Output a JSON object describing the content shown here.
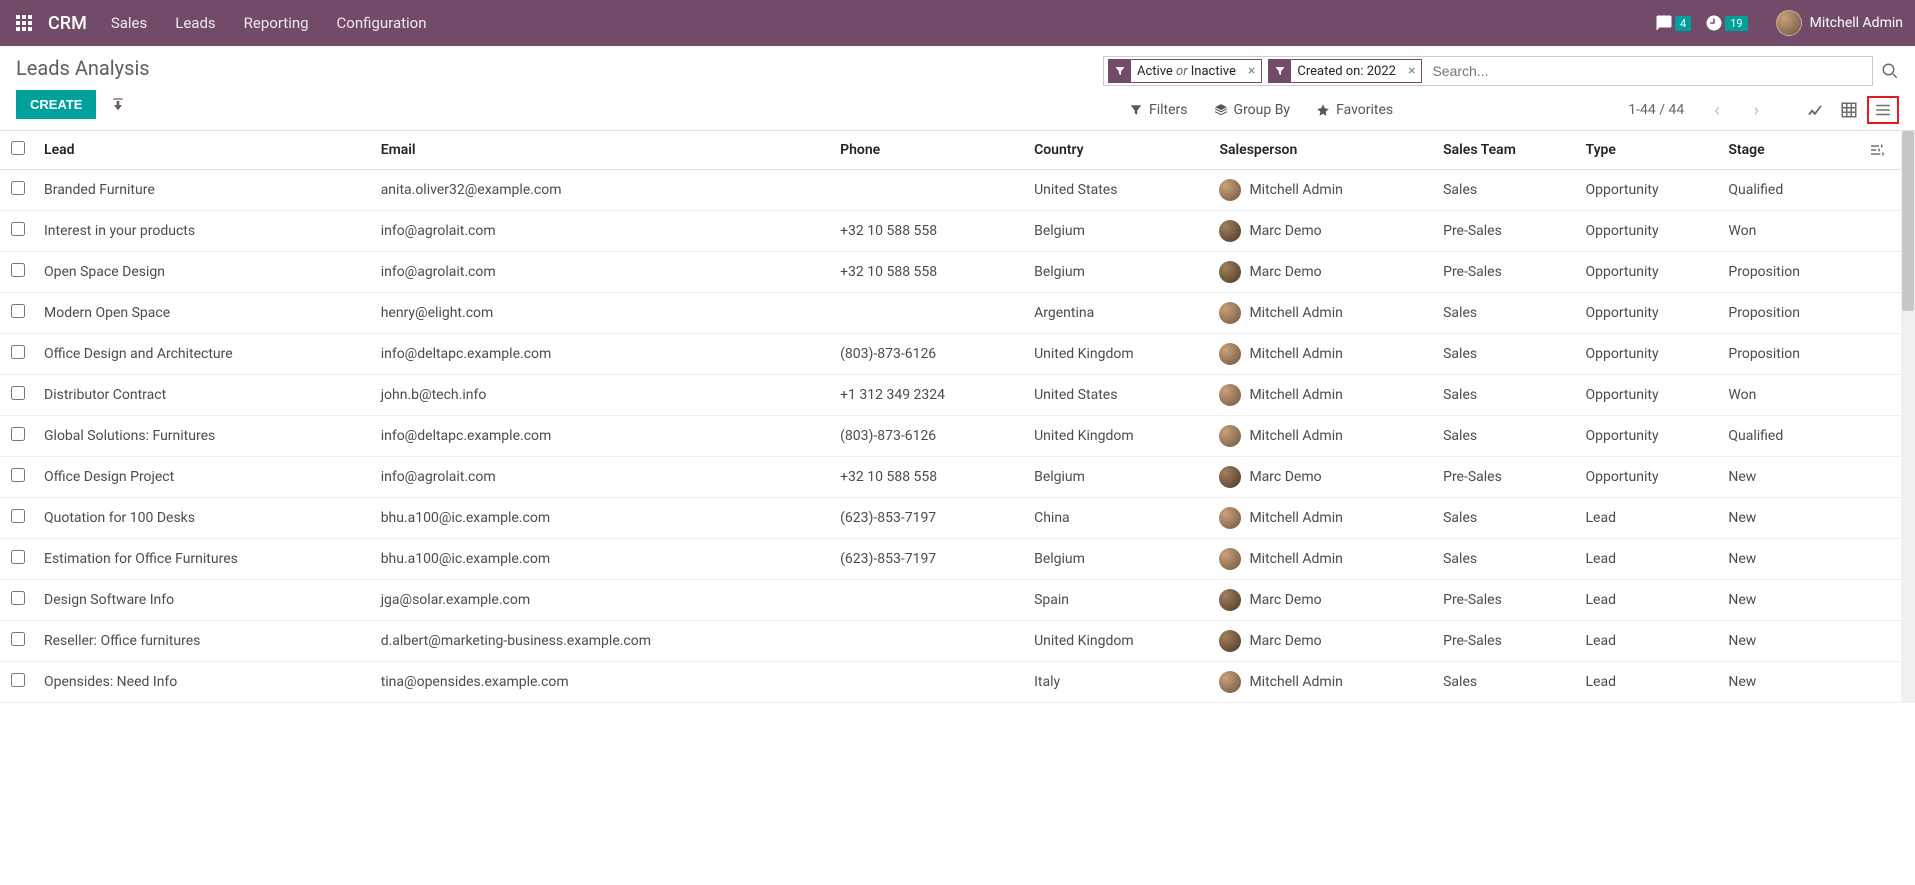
{
  "nav": {
    "brand": "CRM",
    "items": [
      "Sales",
      "Leads",
      "Reporting",
      "Configuration"
    ],
    "msg_badge": "4",
    "clock_badge": "19",
    "user": "Mitchell Admin"
  },
  "page": {
    "title": "Leads Analysis",
    "create_label": "CREATE"
  },
  "search": {
    "facet1_pre": "Active",
    "facet1_mid": "or",
    "facet1_post": "Inactive",
    "facet2": "Created on: 2022",
    "placeholder": "Search..."
  },
  "toolbar": {
    "filters": "Filters",
    "groupby": "Group By",
    "favorites": "Favorites",
    "pager": "1-44 / 44"
  },
  "columns": {
    "lead": "Lead",
    "email": "Email",
    "phone": "Phone",
    "country": "Country",
    "salesperson": "Salesperson",
    "salesteam": "Sales Team",
    "type": "Type",
    "stage": "Stage"
  },
  "rows": [
    {
      "lead": "Branded Furniture",
      "email": "anita.oliver32@example.com",
      "phone": "",
      "country": "United States",
      "sp": "Mitchell Admin",
      "team": "Sales",
      "type": "Opportunity",
      "stage": "Qualified",
      "av": "a"
    },
    {
      "lead": "Interest in your products",
      "email": "info@agrolait.com",
      "phone": "+32 10 588 558",
      "country": "Belgium",
      "sp": "Marc Demo",
      "team": "Pre-Sales",
      "type": "Opportunity",
      "stage": "Won",
      "av": "b"
    },
    {
      "lead": "Open Space Design",
      "email": "info@agrolait.com",
      "phone": "+32 10 588 558",
      "country": "Belgium",
      "sp": "Marc Demo",
      "team": "Pre-Sales",
      "type": "Opportunity",
      "stage": "Proposition",
      "av": "b"
    },
    {
      "lead": "Modern Open Space",
      "email": "henry@elight.com",
      "phone": "",
      "country": "Argentina",
      "sp": "Mitchell Admin",
      "team": "Sales",
      "type": "Opportunity",
      "stage": "Proposition",
      "av": "a"
    },
    {
      "lead": "Office Design and Architecture",
      "email": "info@deltapc.example.com",
      "phone": "(803)-873-6126",
      "country": "United Kingdom",
      "sp": "Mitchell Admin",
      "team": "Sales",
      "type": "Opportunity",
      "stage": "Proposition",
      "av": "a"
    },
    {
      "lead": "Distributor Contract",
      "email": "john.b@tech.info",
      "phone": "+1 312 349 2324",
      "country": "United States",
      "sp": "Mitchell Admin",
      "team": "Sales",
      "type": "Opportunity",
      "stage": "Won",
      "av": "a"
    },
    {
      "lead": "Global Solutions: Furnitures",
      "email": "info@deltapc.example.com",
      "phone": "(803)-873-6126",
      "country": "United Kingdom",
      "sp": "Mitchell Admin",
      "team": "Sales",
      "type": "Opportunity",
      "stage": "Qualified",
      "av": "a"
    },
    {
      "lead": "Office Design Project",
      "email": "info@agrolait.com",
      "phone": "+32 10 588 558",
      "country": "Belgium",
      "sp": "Marc Demo",
      "team": "Pre-Sales",
      "type": "Opportunity",
      "stage": "New",
      "av": "b"
    },
    {
      "lead": "Quotation for 100 Desks",
      "email": "bhu.a100@ic.example.com",
      "phone": "(623)-853-7197",
      "country": "China",
      "sp": "Mitchell Admin",
      "team": "Sales",
      "type": "Lead",
      "stage": "New",
      "av": "a"
    },
    {
      "lead": "Estimation for Office Furnitures",
      "email": "bhu.a100@ic.example.com",
      "phone": "(623)-853-7197",
      "country": "Belgium",
      "sp": "Mitchell Admin",
      "team": "Sales",
      "type": "Lead",
      "stage": "New",
      "av": "a"
    },
    {
      "lead": "Design Software Info",
      "email": "jga@solar.example.com",
      "phone": "",
      "country": "Spain",
      "sp": "Marc Demo",
      "team": "Pre-Sales",
      "type": "Lead",
      "stage": "New",
      "av": "b"
    },
    {
      "lead": "Reseller: Office furnitures",
      "email": "d.albert@marketing-business.example.com",
      "phone": "",
      "country": "United Kingdom",
      "sp": "Marc Demo",
      "team": "Pre-Sales",
      "type": "Lead",
      "stage": "New",
      "av": "b"
    },
    {
      "lead": "Opensides: Need Info",
      "email": "tina@opensides.example.com",
      "phone": "",
      "country": "Italy",
      "sp": "Mitchell Admin",
      "team": "Sales",
      "type": "Lead",
      "stage": "New",
      "av": "a"
    }
  ]
}
